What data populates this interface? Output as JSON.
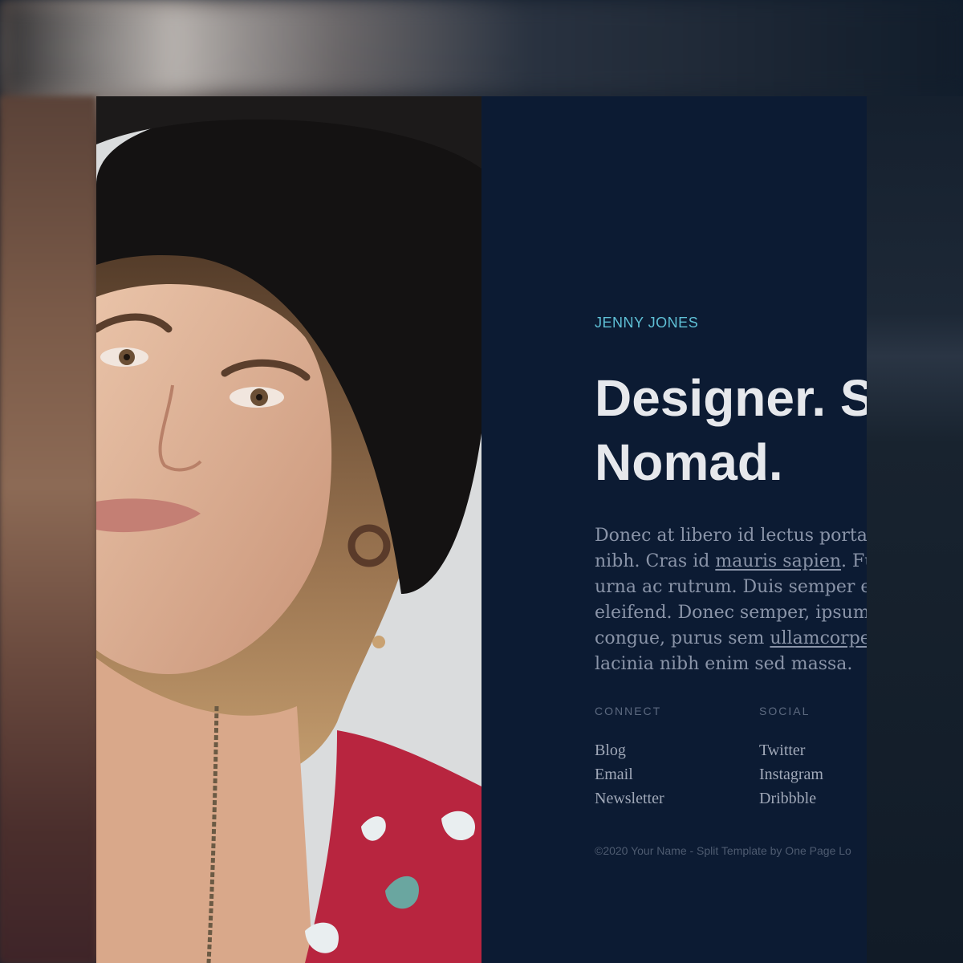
{
  "profile": {
    "name": "JENNY JONES",
    "headline_line1": "Designer. S",
    "headline_line2": "Nomad."
  },
  "bio": {
    "line1": "Donec at libero id lectus porta",
    "line2_a": "nibh. Cras id ",
    "line2_link": "mauris sapien",
    "line2_b": ". Fu",
    "line3": "urna ac rutrum. Duis semper e",
    "line4": "eleifend. Donec semper, ipsum",
    "line5_a": "congue, purus sem ",
    "line5_link": "ullamcorpe",
    "line6": "lacinia nibh enim sed massa."
  },
  "connect": {
    "title": "CONNECT",
    "items": [
      "Blog",
      "Email",
      "Newsletter"
    ]
  },
  "social": {
    "title": "SOCIAL",
    "items": [
      "Twitter",
      "Instagram",
      "Dribbble"
    ]
  },
  "footer": {
    "text": "©2020 Your Name - Split Template by One Page Lo"
  },
  "colors": {
    "panel_bg": "#0c1b33",
    "accent": "#5fc0d6",
    "headline": "#e6e8ec",
    "body_text": "#8a94a8"
  }
}
